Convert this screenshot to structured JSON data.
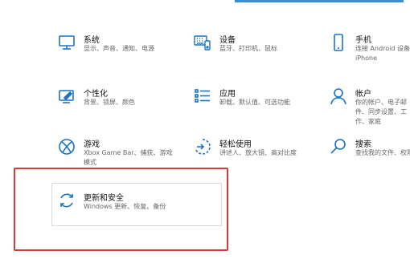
{
  "colors": {
    "accent": "#1a73c8",
    "red_annotation": "#d63a3a",
    "desc_text": "#666666"
  },
  "tiles": [
    {
      "title": "系统",
      "desc": "显示、声音、通知、电源",
      "icon": "monitor-icon"
    },
    {
      "title": "设备",
      "desc": "蓝牙、打印机、鼠标",
      "icon": "keyboard-icon"
    },
    {
      "title": "手机",
      "desc": "连接 Android 设备和 iPhone",
      "icon": "phone-icon"
    },
    {
      "title": "个性化",
      "desc": "背景、锁屏、颜色",
      "icon": "personalize-icon"
    },
    {
      "title": "应用",
      "desc": "卸载、默认值、可选功能",
      "icon": "apps-list-icon"
    },
    {
      "title": "帐户",
      "desc": "你的帐户、电子邮件、同步设置、工作、家庭",
      "icon": "person-icon"
    },
    {
      "title": "游戏",
      "desc": "Xbox Game Bar、捕获、游戏模式",
      "icon": "xbox-icon"
    },
    {
      "title": "轻松使用",
      "desc": "讲述人、放大镜、高对比度",
      "icon": "ease-of-access-icon"
    },
    {
      "title": "搜索",
      "desc": "查找我的文件、权限",
      "icon": "search-icon"
    },
    {
      "title": "更新和安全",
      "desc": "Windows 更新、恢复、备份",
      "icon": "sync-icon"
    }
  ]
}
